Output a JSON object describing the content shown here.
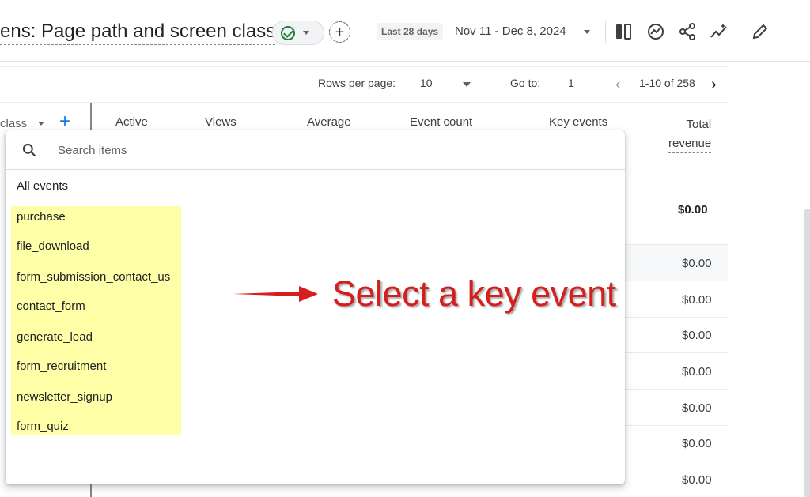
{
  "header": {
    "title": "ens: Page path and screen class",
    "date_label": "Last 28 days",
    "date_range": "Nov 11 - Dec 8, 2024",
    "icons": [
      "compare-icon",
      "insights-icon",
      "share-icon",
      "trend-icon",
      "edit-icon"
    ]
  },
  "pagination": {
    "rows_label": "Rows per page:",
    "rows_value": "10",
    "goto_label": "Go to:",
    "goto_value": "1",
    "range": "1-10 of 258"
  },
  "table": {
    "dimension_header": "class",
    "columns": [
      "Active",
      "Views",
      "Average",
      "Event count",
      "Key events"
    ],
    "total_revenue_line1": "Total",
    "total_revenue_line2": "revenue",
    "total_value": "$0.00",
    "row_values": [
      "$0.00",
      "$0.00",
      "$0.00",
      "$0.00",
      "$0.00",
      "$0.00",
      "$0.00"
    ]
  },
  "dropdown": {
    "search_placeholder": "Search items",
    "all_events": "All events",
    "items": [
      "purchase",
      "file_download",
      "form_submission_contact_us",
      "contact_form",
      "generate_lead",
      "form_recruitment",
      "newsletter_signup",
      "form_quiz"
    ]
  },
  "annotation": {
    "text": "Select a key event",
    "color": "#d41f1f"
  },
  "colors": {
    "accent": "#1a73e8",
    "highlight": "#ffff99",
    "success": "#188038"
  }
}
